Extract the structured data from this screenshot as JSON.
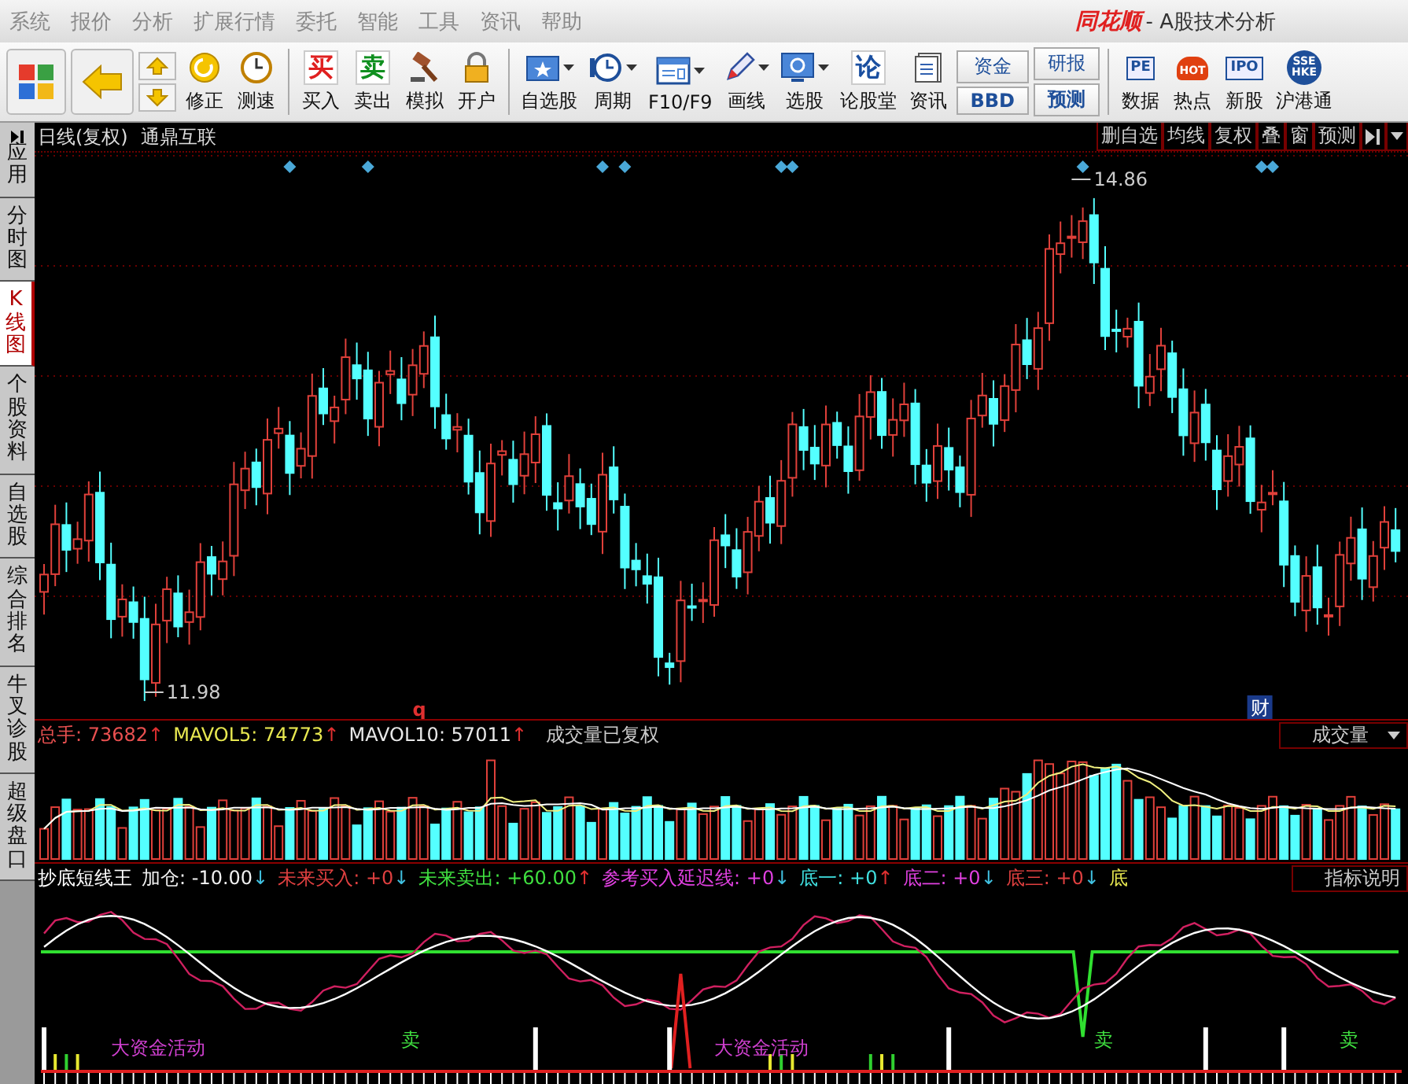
{
  "menu_bar": {
    "items": [
      "系统",
      "报价",
      "分析",
      "扩展行情",
      "委托",
      "智能",
      "工具",
      "资讯",
      "帮助"
    ],
    "brand": "同花顺",
    "title": "- A股技术分析"
  },
  "toolbar": [
    {
      "kind": "tiles"
    },
    {
      "kind": "back"
    },
    {
      "kind": "updown"
    },
    {
      "kind": "refresh",
      "label": "修正",
      "dropdown": false
    },
    {
      "kind": "clock",
      "label": "测速",
      "dropdown": false
    },
    {
      "kind": "sep"
    },
    {
      "kind": "glyph",
      "glyph": "买",
      "color": "#e02020",
      "label": "买入",
      "dropdown": false
    },
    {
      "kind": "glyph",
      "glyph": "卖",
      "color": "#0f8f1f",
      "label": "卖出",
      "dropdown": false
    },
    {
      "kind": "gavel",
      "label": "模拟",
      "dropdown": false
    },
    {
      "kind": "lock",
      "label": "开户",
      "dropdown": false
    },
    {
      "kind": "sep"
    },
    {
      "kind": "star",
      "label": "自选股",
      "dropdown": true
    },
    {
      "kind": "period",
      "label": "周期",
      "dropdown": true
    },
    {
      "kind": "window",
      "label": "F10/F9",
      "dropdown": true
    },
    {
      "kind": "pen",
      "label": "画线",
      "dropdown": true
    },
    {
      "kind": "screen",
      "label": "选股",
      "dropdown": true
    },
    {
      "kind": "glyph",
      "glyph": "论",
      "color": "#1a4fa0",
      "label": "论股堂",
      "dropdown": false
    },
    {
      "kind": "doc",
      "label": "资讯",
      "dropdown": false
    },
    {
      "kind": "pair",
      "labels": [
        "资金",
        "BBD"
      ]
    },
    {
      "kind": "pair",
      "labels": [
        "研报",
        "预测"
      ]
    },
    {
      "kind": "sep"
    },
    {
      "kind": "badge",
      "badge": "PE",
      "label": "数据",
      "dropdown": false
    },
    {
      "kind": "hot",
      "badge": "HOT",
      "label": "热点",
      "dropdown": false
    },
    {
      "kind": "badge",
      "badge": "IPO",
      "label": "新股",
      "dropdown": false
    },
    {
      "kind": "globe",
      "badge": "SSE HKE",
      "label": "沪港通",
      "dropdown": false
    }
  ],
  "sidebar": {
    "tabs": [
      {
        "kind": "apply",
        "label": "应用",
        "selected": false
      },
      {
        "kind": "view",
        "label": "分时图",
        "selected": false
      },
      {
        "kind": "view",
        "label": "K线图",
        "selected": true
      },
      {
        "kind": "view",
        "label": "个股资料",
        "selected": false
      },
      {
        "kind": "view",
        "label": "自选股",
        "selected": false
      },
      {
        "kind": "view",
        "label": "综合排名",
        "selected": false
      },
      {
        "kind": "view",
        "label": "牛叉诊股",
        "selected": false
      },
      {
        "kind": "view",
        "label": "超级盘口",
        "selected": false
      }
    ]
  },
  "chart_header": {
    "period": "日线(复权)",
    "stock": "通鼎互联",
    "buttons": [
      "删自选",
      "均线",
      "复权",
      "叠",
      "窗",
      "预测"
    ]
  },
  "price_chart": {
    "high_label": "14.86",
    "low_label": "11.98",
    "event_mark": "q",
    "finance_mark": "财"
  },
  "volume_panel": {
    "items": [
      {
        "text": "总手: 73682",
        "color": "#e85050",
        "arrow": {
          "text": "↑",
          "color": "#e03030"
        }
      },
      {
        "text": "MAVOL5: 74773",
        "color": "#e8e850",
        "arrow": {
          "text": "↑",
          "color": "#e03030"
        }
      },
      {
        "text": "MAVOL10: 57011",
        "color": "#e8e8e8",
        "arrow": {
          "text": "↑",
          "color": "#e03030"
        }
      }
    ],
    "note": "成交量已复权",
    "selector": "成交量"
  },
  "indicator_panel": {
    "name": "抄底短线王",
    "items": [
      {
        "text": "加仓: -10.00",
        "color": "#f0f0f0",
        "arrow": {
          "text": "↓",
          "color": "#40c0e0"
        }
      },
      {
        "text": "未来买入: +0",
        "color": "#e04040",
        "arrow": {
          "text": "↓",
          "color": "#40c0e0"
        }
      },
      {
        "text": "未来卖出: +60.00",
        "color": "#40e040",
        "arrow": {
          "text": "↑",
          "color": "#e03030"
        }
      },
      {
        "text": "参考买入延迟线: +0",
        "color": "#e040e0",
        "arrow": {
          "text": "↓",
          "color": "#40c0e0"
        }
      },
      {
        "text": "底一: +0",
        "color": "#40e0e0",
        "arrow": {
          "text": "↑",
          "color": "#e03030"
        }
      },
      {
        "text": "底二: +0",
        "color": "#e040e0",
        "arrow": {
          "text": "↓",
          "color": "#40c0e0"
        }
      },
      {
        "text": "底三: +0",
        "color": "#e04040",
        "arrow": {
          "text": "↓",
          "color": "#40c0e0"
        }
      },
      {
        "text": "底",
        "color": "#e8e850"
      }
    ],
    "help_button": "指标说明",
    "labels": [
      {
        "kind": "fund",
        "text": "大资金活动"
      },
      {
        "kind": "sell",
        "text": "卖"
      },
      {
        "kind": "fund",
        "text": "大资金活动"
      },
      {
        "kind": "sell",
        "text": "卖"
      },
      {
        "kind": "sell",
        "text": "卖"
      }
    ]
  }
}
